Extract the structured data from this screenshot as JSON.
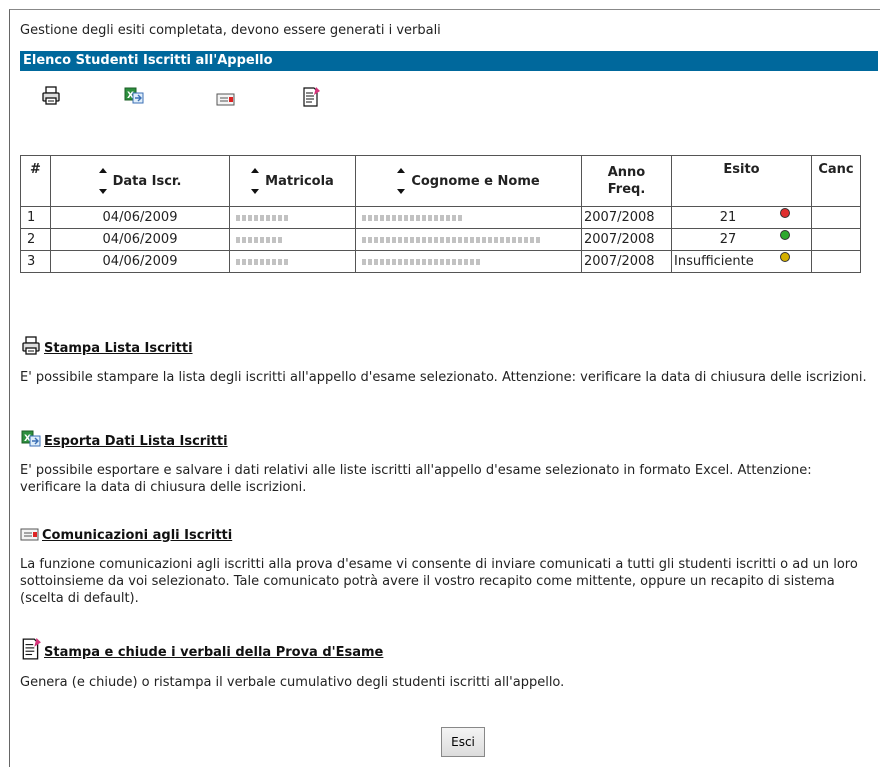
{
  "status_message": "Gestione degli esiti completata, devono essere generati i verbali",
  "section_title": "Elenco Studenti Iscritti all'Appello",
  "toolbar": {
    "print_icon": "printer-icon",
    "export_icon": "excel-export-icon",
    "message_icon": "envelope-icon",
    "report_icon": "document-sign-icon"
  },
  "table": {
    "headers": {
      "index": "#",
      "date": "Data Iscr.",
      "matricola": "Matricola",
      "name": "Cognome e Nome",
      "year_line1": "Anno",
      "year_line2": "Freq.",
      "esito": "Esito",
      "canc": "Canc"
    },
    "rows": [
      {
        "index": "1",
        "date": "04/06/2009",
        "year": "2007/2008",
        "esito": "21",
        "status_color": "#e03030"
      },
      {
        "index": "2",
        "date": "04/06/2009",
        "year": "2007/2008",
        "esito": "27",
        "status_color": "#2fa82f"
      },
      {
        "index": "3",
        "date": "04/06/2009",
        "year": "2007/2008",
        "esito": "Insufficiente",
        "status_color": "#d4b000"
      }
    ]
  },
  "links": [
    {
      "label": "Stampa Lista Iscritti",
      "icon": "printer-icon",
      "description": "E' possibile stampare la lista degli iscritti all'appello d'esame selezionato. Attenzione: verificare la data di chiusura delle iscrizioni."
    },
    {
      "label": "Esporta Dati Lista Iscritti",
      "icon": "excel-export-icon",
      "description": "E' possibile esportare e salvare i dati relativi alle liste iscritti all'appello d'esame selezionato in formato Excel. Attenzione: verificare la data di chiusura delle iscrizioni."
    },
    {
      "label": "Comunicazioni agli Iscritti",
      "icon": "envelope-icon",
      "description": "La funzione comunicazioni agli iscritti alla prova d'esame vi consente di inviare comunicati a tutti gli studenti iscritti o ad un loro sottoinsieme da voi selezionato. Tale comunicato potrà avere il vostro recapito come mittente, oppure un recapito di sistema (scelta di default)."
    },
    {
      "label": "Stampa e chiude i verbali della Prova d'Esame",
      "icon": "document-sign-icon",
      "description": "Genera (e chiude) o ristampa il verbale cumulativo degli studenti iscritti all'appello."
    }
  ],
  "exit_button": "Esci"
}
